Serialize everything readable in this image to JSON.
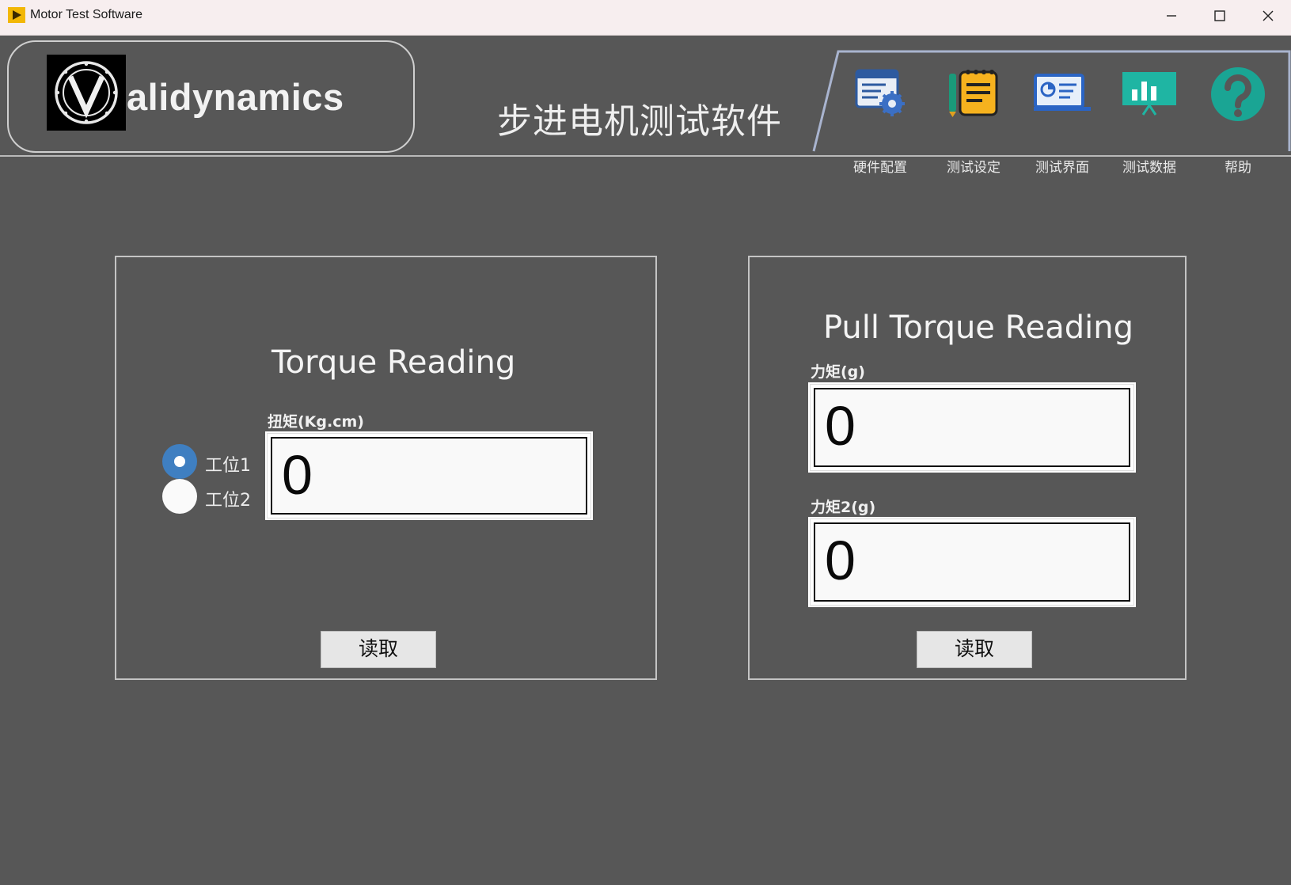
{
  "window": {
    "title": "Motor Test Software"
  },
  "header": {
    "logo_text": "alidynamics",
    "app_title": "步进电机测试软件"
  },
  "toolbar": {
    "items": [
      {
        "label": "硬件配置",
        "icon": "hardware-config-icon"
      },
      {
        "label": "测试设定",
        "icon": "test-settings-icon"
      },
      {
        "label": "测试界面",
        "icon": "test-interface-icon"
      },
      {
        "label": "测试数据",
        "icon": "test-data-icon"
      },
      {
        "label": "帮助",
        "icon": "help-icon"
      }
    ]
  },
  "torque_panel": {
    "title": "Torque Reading",
    "field_label": "扭矩(Kg.cm)",
    "value": "0",
    "stations": [
      {
        "label": "工位1",
        "selected": true
      },
      {
        "label": "工位2",
        "selected": false
      }
    ],
    "read_button": "读取"
  },
  "pull_panel": {
    "title": "Pull Torque Reading",
    "field1_label": "力矩(g)",
    "field1_value": "0",
    "field2_label": "力矩2(g)",
    "field2_value": "0",
    "read_button": "读取"
  },
  "colors": {
    "background": "#575757",
    "radio_selected": "#3f7fc1",
    "help_icon": "#1aa594",
    "data_icon": "#1fb5a3"
  }
}
